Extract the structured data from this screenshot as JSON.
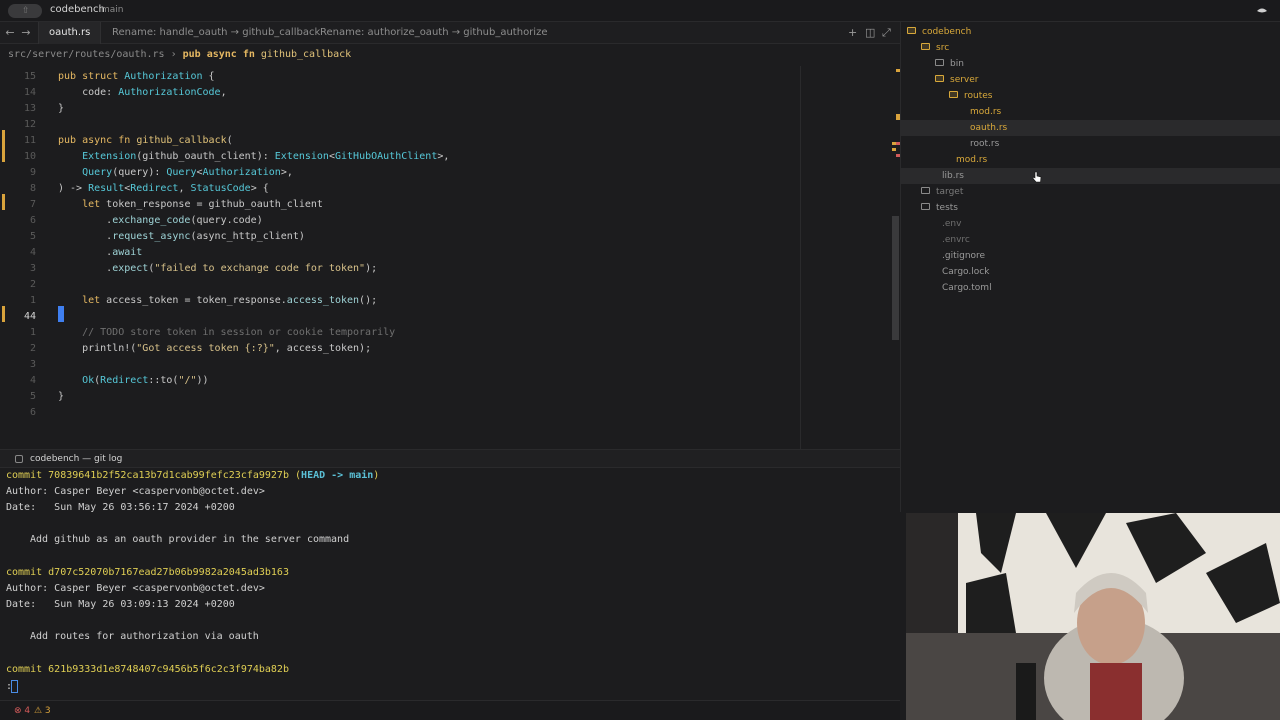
{
  "titlebar": {
    "project": "codebench",
    "branch": "main",
    "badge": "⇧"
  },
  "tabs": [
    {
      "label": "oauth.rs",
      "active": true
    },
    {
      "label": "Rename: handle_oauth → github_callback",
      "active": false
    },
    {
      "label": "Rename: authorize_oauth → github_authorize",
      "active": false
    }
  ],
  "nav": {
    "back": "←",
    "forward": "→"
  },
  "tabbar_actions": {
    "new": "+",
    "split": "◫",
    "expand": "⤢"
  },
  "breadcrumb": {
    "path": "src/server/routes/oauth.rs",
    "sep": " › ",
    "kw": "pub async fn",
    "fn": "github_callback"
  },
  "editor": {
    "cursor_line": 17,
    "lines": [
      {
        "num": "15",
        "text": "pub struct Authorization {"
      },
      {
        "num": "14",
        "text": "    code: AuthorizationCode,"
      },
      {
        "num": "13",
        "text": "}"
      },
      {
        "num": "12",
        "text": ""
      },
      {
        "num": "11",
        "text": "pub async fn github_callback("
      },
      {
        "num": "10",
        "text": "    Extension(github_oauth_client): Extension<GitHubOAuthClient>,"
      },
      {
        "num": "9",
        "text": "    Query(query): Query<Authorization>,"
      },
      {
        "num": "8",
        "text": ") -> Result<Redirect, StatusCode> {"
      },
      {
        "num": "7",
        "text": "    let token_response = github_oauth_client"
      },
      {
        "num": "6",
        "text": "        .exchange_code(query.code)"
      },
      {
        "num": "5",
        "text": "        .request_async(async_http_client)"
      },
      {
        "num": "4",
        "text": "        .await"
      },
      {
        "num": "3",
        "text": "        .expect(\"failed to exchange code for token\");"
      },
      {
        "num": "2",
        "text": ""
      },
      {
        "num": "1",
        "text": "    let access_token = token_response.access_token();"
      },
      {
        "num": "44",
        "text": ""
      },
      {
        "num": "1",
        "text": "    // TODO store token in session or cookie temporarily"
      },
      {
        "num": "2",
        "text": "    println!(\"Got access token {:?}\", access_token);"
      },
      {
        "num": "3",
        "text": ""
      },
      {
        "num": "4",
        "text": "    Ok(Redirect::to(\"/\"))"
      },
      {
        "num": "5",
        "text": "}"
      },
      {
        "num": "6",
        "text": ""
      }
    ]
  },
  "terminal": {
    "title": "codebench — git log",
    "commits": [
      {
        "hash": "70839641b2f52ca13b7d1cab99fefc23cfa9927b",
        "head": "HEAD -> main",
        "author": "Casper Beyer <caspervonb@octet.dev>",
        "date": "Sun May 26 03:56:17 2024 +0200",
        "message": "Add github as an oauth provider in the server command"
      },
      {
        "hash": "d707c52070b7167ead27b06b9982a2045ad3b163",
        "head": "",
        "author": "Casper Beyer <caspervonb@octet.dev>",
        "date": "Sun May 26 03:09:13 2024 +0200",
        "message": "Add routes for authorization via oauth"
      },
      {
        "hash": "621b9333d1e8748407c9456b5f6c2c3f974ba82b",
        "head": "",
        "author": "",
        "date": "",
        "message": ""
      }
    ],
    "prompt": ":",
    "labels": {
      "commit": "commit ",
      "author": "Author: ",
      "date": "Date:   "
    }
  },
  "statusbar": {
    "errors": "⊗ 4",
    "warnings": "⚠ 3"
  },
  "filetree": {
    "items": [
      {
        "label": "codebench",
        "depth": 0,
        "type": "folder-open",
        "color": "#d8a83a"
      },
      {
        "label": "src",
        "depth": 1,
        "type": "folder-open",
        "color": "#d8a83a"
      },
      {
        "label": "bin",
        "depth": 2,
        "type": "folder",
        "color": "#9a9a9a"
      },
      {
        "label": "server",
        "depth": 2,
        "type": "folder-open",
        "color": "#d8a83a"
      },
      {
        "label": "routes",
        "depth": 3,
        "type": "folder-open",
        "color": "#d8a83a"
      },
      {
        "label": "mod.rs",
        "depth": 4,
        "type": "file",
        "color": "#d8a83a"
      },
      {
        "label": "oauth.rs",
        "depth": 4,
        "type": "file",
        "color": "#d8a83a",
        "selected": true
      },
      {
        "label": "root.rs",
        "depth": 4,
        "type": "file",
        "color": "#9a9a9a"
      },
      {
        "label": "mod.rs",
        "depth": 3,
        "type": "file",
        "color": "#d8a83a"
      },
      {
        "label": "lib.rs",
        "depth": 2,
        "type": "file",
        "color": "#9a9a9a",
        "selected": true
      },
      {
        "label": "target",
        "depth": 1,
        "type": "folder",
        "color": "#7a7a7a"
      },
      {
        "label": "tests",
        "depth": 1,
        "type": "folder",
        "color": "#9a9a9a"
      },
      {
        "label": ".env",
        "depth": 2,
        "type": "file",
        "color": "#6f6f6f"
      },
      {
        "label": ".envrc",
        "depth": 2,
        "type": "file",
        "color": "#6f6f6f"
      },
      {
        "label": ".gitignore",
        "depth": 2,
        "type": "file",
        "color": "#9a9a9a"
      },
      {
        "label": "Cargo.lock",
        "depth": 2,
        "type": "file",
        "color": "#9a9a9a"
      },
      {
        "label": "Cargo.toml",
        "depth": 2,
        "type": "file",
        "color": "#9a9a9a"
      }
    ]
  },
  "colors": {
    "accent": "#3f7ff0",
    "git_modified": "#d9a33c",
    "keyword": "#e5b862",
    "type": "#56c8d8"
  }
}
